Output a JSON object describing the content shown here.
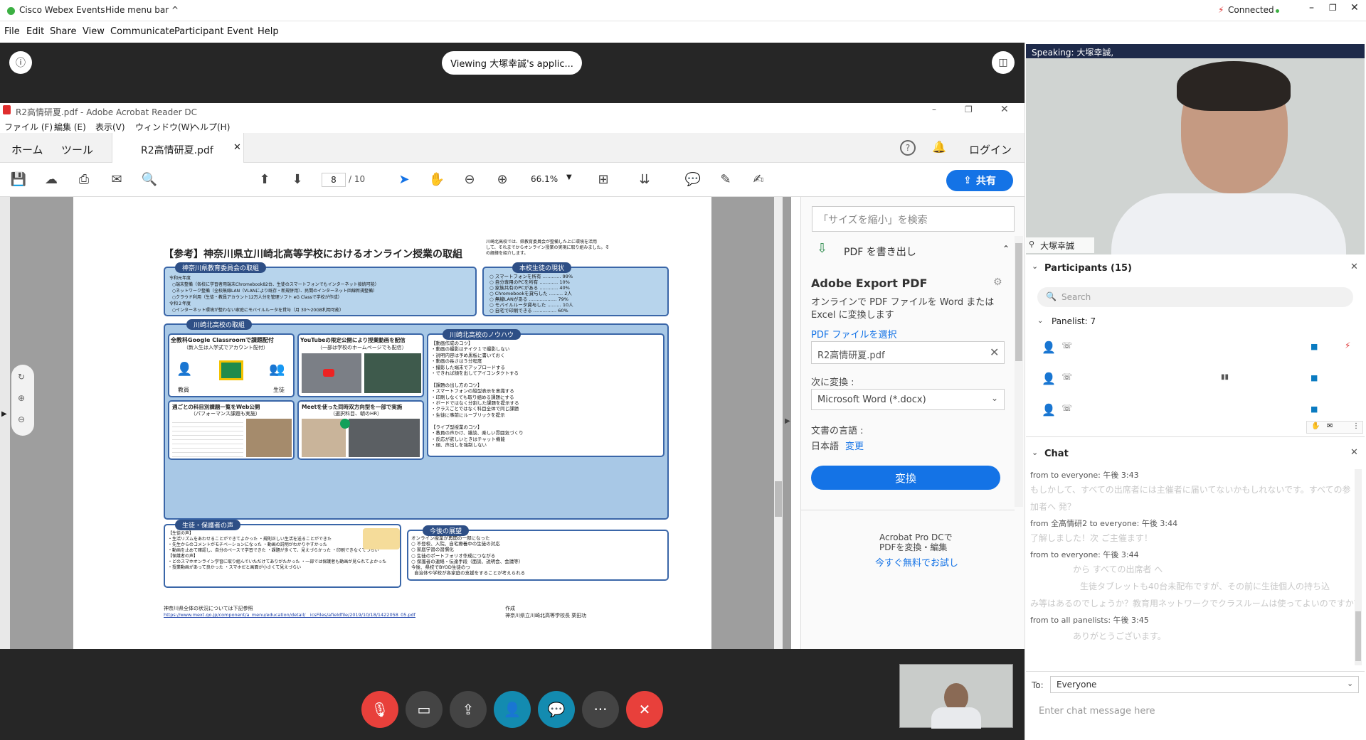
{
  "titlebar": {
    "app_name": "Cisco Webex Events",
    "hide_menu": "Hide menu bar",
    "connection": "Connected"
  },
  "menu": [
    "File",
    "Edit",
    "Share",
    "View",
    "Communicate",
    "Participant",
    "Event",
    "Help"
  ],
  "stage": {
    "viewing_text": "Viewing 大塚幸誠's applic..."
  },
  "acrobat": {
    "window_title": "R2高情研夏.pdf - Adobe Acrobat Reader DC",
    "menu": [
      "ファイル (F)",
      "編集 (E)",
      "表示(V)",
      "ウィンドウ(W)",
      "ヘルプ(H)"
    ],
    "tab_home": "ホーム",
    "tab_tools": "ツール",
    "doc_tab": "R2高情研夏.pdf",
    "login": "ログイン",
    "page_current": "8",
    "page_total": "/ 10",
    "zoom": "66.1%",
    "share_label": "共有",
    "right_pane": {
      "search_placeholder": "「サイズを縮小」を検索",
      "export_header": "PDF を書き出し",
      "export_title": "Adobe Export PDF",
      "export_desc": "オンラインで PDF ファイルを Word または Excel に変換します",
      "select_file": "PDF ファイルを選択",
      "selected_file": "R2高情研夏.pdf",
      "convert_to_label": "次に変換 :",
      "convert_to_value": "Microsoft Word (*.docx)",
      "lang_label": "文書の言語 :",
      "lang_value": "日本語",
      "lang_change": "変更",
      "convert_button": "変換",
      "promo_line1": "Acrobat Pro DCで",
      "promo_line2": "PDFを変換・編集",
      "promo_link": "今すぐ無料でお試し"
    }
  },
  "slide": {
    "title": "【参考】神奈川県立川崎北高等学校におけるオンライン授業の取組",
    "header_note": "川崎北高校では、県教育委員会が整備した上に環境を活用\nして、それまでからオンライン授業の実現に取り組みました。そ\nの経緯を紹介します。",
    "board_header": "神奈川県教育委員会の取組",
    "board_text": "令和元年度\n  ○端末整備（各校に学習者用端末Chromebook82台、生徒のスマートフォンでもインターネット接続可能）\n  ○ネットワーク整備（全校無線LAN（VLANにより既存・新規併用）、民間のインターネット回線新規整備）\n  ○クラウド利用（生徒・教員アカウント12万人分を管理ソフト eG Classで学校が作成）\n令和２年度\n  ○インターネット環境が整わない家庭にモバイルルータを貸与（月 30～20GB利用可能）",
    "status_header": "本校生徒の現状",
    "status_text": "○ スマートフォンを所有 ………… 99%\n○ 自分専用のPCを所有 ………… 10%\n○ 家族共有のPCがある ………… 40%\n○ Chromebookを貸与した ……… 2人\n○ 無線LANがある ……………… 79%\n○ モバイルルータ貸与した ……… 10人\n○ 自宅で印刷できる …………… 60%",
    "school_header": "川崎北高校の取組",
    "classroom_header": "全教科Google Classroomで課題配付",
    "classroom_sub": "（新入生は入学式でアカウント配付）",
    "teacher_label": "教員",
    "student_label": "生徒",
    "youtube_header": "YouTubeの限定公開により授業動画を配信",
    "youtube_sub": "（一部は学校のホームページでも配信）",
    "weekly_header": "週ごとの科目別課題一覧をWeb公開",
    "weekly_sub": "（パフォーマンス課題も実施）",
    "meet_header": "Meetを使った同時双方向型を一部で実施",
    "meet_sub": "（選択科目、朝のHR）",
    "knowhow_header": "川崎北高校のノウハウ",
    "knowhow_text": "【動画作成のコツ】\n・動画の撮影はテイク１で撮影しない\n・説明内容は予め黒板に書いておく\n・動画の長さは５分程度\n・撮影した端末でアップロードする\n・できれば顔を出してアイコンタクトする\n\n【課題の出し方のコツ】\n・スマートフォンの縦型表示を意識する\n・印刷しなくても取り組める課題にする\n・ボードではなく分割した課題を提示する\n・クラスごとではなく科目全体で同じ課題\n・生徒に事前にルーブリックを提示\n\n【ライブ型授業のコツ】\n・教員の声かけ、雑談、楽しい雰囲気づくり\n・反応が欲しいときはチャット機能\n・顔、声出しを強制しない",
    "voices_header": "生徒・保護者の声",
    "voices_text": "【生徒の声】\n・生活リズムをあわせることができてよかった ・規則正しい生活を送ることができた\n・先生からのコメントがモチベーションになった ・動画の説明がわかりやすかった\n・動画を止めて確認し、自分のペースで学習できた ・課題が多くて、見えづらかった ・印刷できなくてつらい\n【保護者の声】\n・どのスマホオンライン学習に取り組んでいただけてありがたかった ・一部では保護者も動画が見られてよかった\n・授業動画があって良かった ・スマホだと画面が小さくて見えづらい",
    "future_header": "今後の展望",
    "future_text": "オンライン授業が再開の一部になった\n○ 不登校、入院、自宅療養中の生徒の対応\n○ 家庭学習の習慣化\n○ 生徒のポートフォリオ作成につながる\n○ 保護者の連絡・伝達手段（面談、説明会、会議等）\n今後、県校でBYOD生徒のつ\n  自治体や学校が各家庭の支援をすることが考えられる",
    "footer_note": "神奈川県全体の状況については下記参照",
    "footer_url": "https://www.mext.go.jp/component/a_menu/education/detail/__icsFiles/afieldfile/2019/10/18/1422058_05.pdf",
    "author_label": "作成",
    "author": "神奈川県立川崎北高等学校長 栗田功"
  },
  "side": {
    "speaking": "Speaking: 大塚幸誠,",
    "video_name": "大塚幸誠",
    "participants_title": "Participants (15)",
    "search_placeholder": "Search",
    "panelist_label": "Panelist: 7",
    "chat_title": "Chat",
    "chat": [
      {
        "meta": "from               to everyone:  午後 3:43",
        "text": "もしかして、すべての出席者には主催者に届いてないかもしれないです。すべての参"
      },
      {
        "meta": "",
        "text": "加者へ 発？"
      },
      {
        "meta": "from 全高情研2 to everyone:  午後 3:44",
        "text": "了解しました！次             ご主催ます！"
      },
      {
        "meta": "from               to everyone:  午後 3:44",
        "text": "から すべての出席者 へ"
      },
      {
        "meta": "",
        "text": "生徒タブレットも40台未配布ですが、その前に生徒個人の持ち込"
      },
      {
        "meta": "",
        "text": "み等はあるのでしょうか？教育用ネットワークでクラスルームは使ってよいのですか？"
      },
      {
        "meta": "from               to all panelists:  午後 3:45",
        "text": "ありがとうございます。"
      }
    ],
    "to_label": "To:",
    "to_value": "Everyone",
    "chat_placeholder": "Enter chat message here"
  },
  "colors": {
    "accent": "#0a7bc1",
    "adobe_blue": "#1473e6",
    "end_red": "#e8403b",
    "teal": "#138bb0"
  }
}
